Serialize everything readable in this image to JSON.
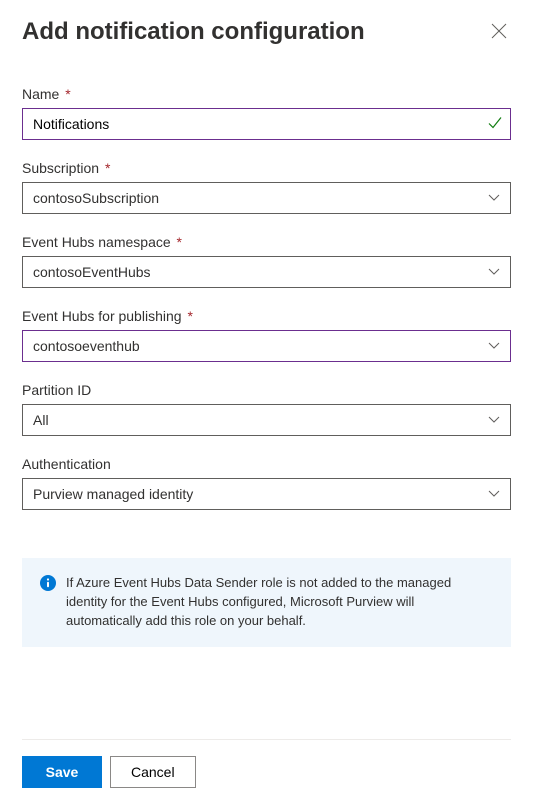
{
  "header": {
    "title": "Add notification configuration"
  },
  "fields": {
    "name": {
      "label": "Name",
      "value": "Notifications",
      "required": true,
      "valid": true
    },
    "subscription": {
      "label": "Subscription",
      "value": "contosoSubscription",
      "required": true
    },
    "eventHubsNamespace": {
      "label": "Event Hubs namespace",
      "value": "contosoEventHubs",
      "required": true
    },
    "eventHubsPublishing": {
      "label": "Event Hubs for publishing",
      "value": "contosoeventhub",
      "required": true
    },
    "partitionId": {
      "label": "Partition ID",
      "value": "All",
      "required": false
    },
    "authentication": {
      "label": "Authentication",
      "value": "Purview managed identity",
      "required": false
    }
  },
  "info": {
    "text": "If Azure Event Hubs Data Sender role is not added to the managed identity for the Event Hubs configured, Microsoft Purview will automatically add this role on your behalf."
  },
  "footer": {
    "save": "Save",
    "cancel": "Cancel"
  },
  "requiredMark": "*"
}
